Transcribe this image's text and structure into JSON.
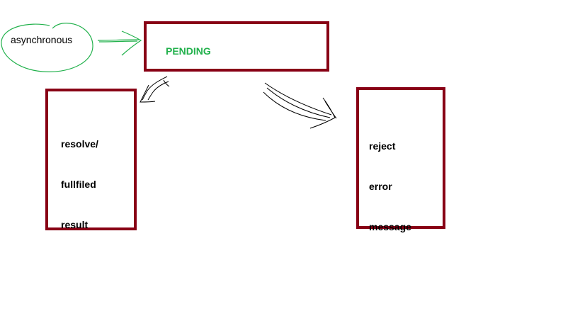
{
  "asynchronous": {
    "label": "asynchronous",
    "color": "#22b14c"
  },
  "pending": {
    "label": "PENDING",
    "color": "#22b14c",
    "border_color": "#880015"
  },
  "resolve": {
    "lines": [
      "resolve/",
      "fullfiled",
      "result"
    ],
    "border_color": "#880015"
  },
  "reject": {
    "lines": [
      "reject",
      "error",
      "message"
    ],
    "border_color": "#880015"
  },
  "arrows": [
    {
      "from": "asynchronous",
      "to": "pending",
      "color": "#22b14c"
    },
    {
      "from": "pending",
      "to": "resolve",
      "color": "#000000"
    },
    {
      "from": "pending",
      "to": "reject",
      "color": "#000000"
    }
  ]
}
